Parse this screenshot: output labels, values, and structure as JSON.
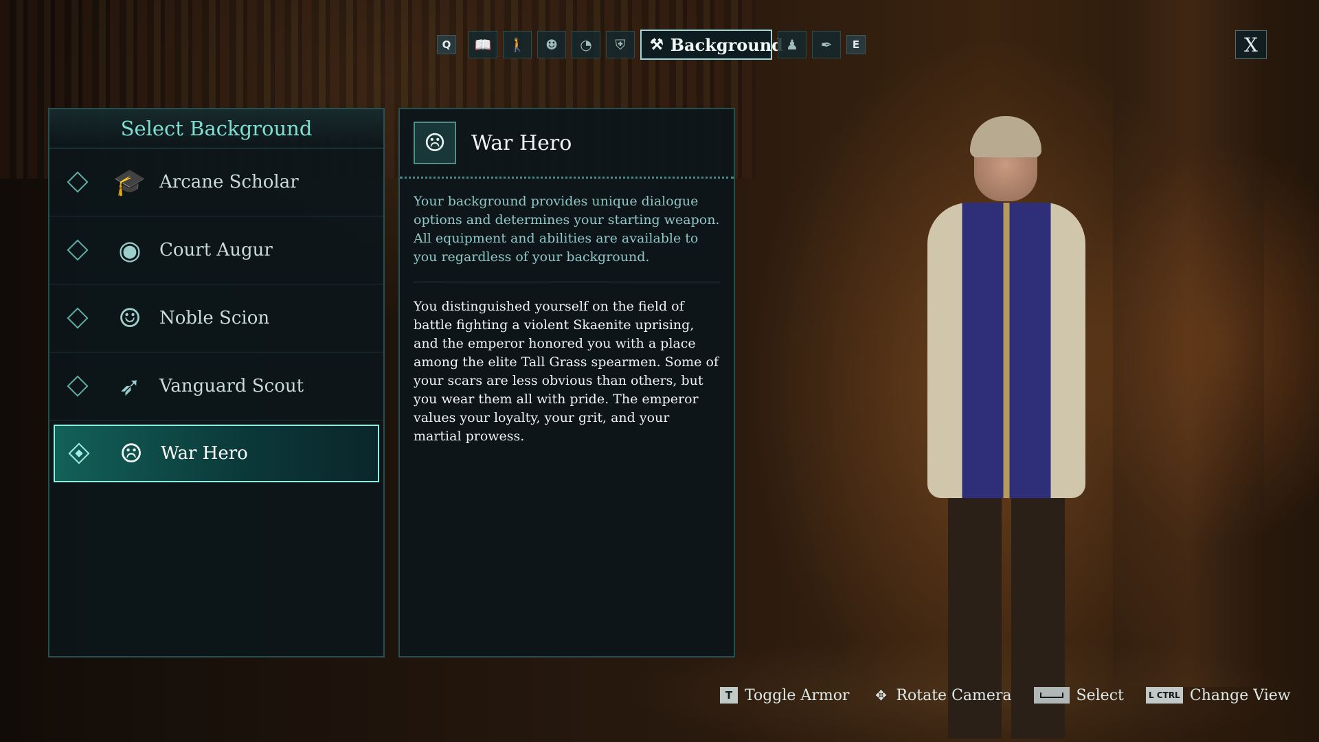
{
  "tabs": {
    "prev_key": "Q",
    "next_key": "E",
    "items": [
      {
        "icon": "book-icon",
        "glyph": "📖"
      },
      {
        "icon": "body-icon",
        "glyph": "🚶"
      },
      {
        "icon": "face-icon",
        "glyph": "☻"
      },
      {
        "icon": "head-icon",
        "glyph": "◔"
      },
      {
        "icon": "shield-icon",
        "glyph": "⛨"
      },
      {
        "icon": "background-icon",
        "glyph": "⚒",
        "label": "Background",
        "active": true
      },
      {
        "icon": "bust-icon",
        "glyph": "♟"
      },
      {
        "icon": "quill-icon",
        "glyph": "✒"
      }
    ],
    "close_label": "X"
  },
  "select_panel": {
    "title": "Select Background",
    "items": [
      {
        "label": "Arcane Scholar",
        "icon": "mortarboard-icon",
        "glyph": "🎓",
        "selected": false
      },
      {
        "label": "Court Augur",
        "icon": "eye-orb-icon",
        "glyph": "◉",
        "selected": false
      },
      {
        "label": "Noble Scion",
        "icon": "noble-face-icon",
        "glyph": "☺",
        "selected": false
      },
      {
        "label": "Vanguard Scout",
        "icon": "spear-icon",
        "glyph": "➶",
        "selected": false
      },
      {
        "label": "War Hero",
        "icon": "eyepatch-face-icon",
        "glyph": "☹",
        "selected": true
      }
    ]
  },
  "detail": {
    "name": "War Hero",
    "icon": "eyepatch-face-icon",
    "glyph": "☹",
    "intro": "Your background provides unique dialogue options and determines your starting weapon. All equipment and abilities are available to you regardless of your background.",
    "body": "You distinguished yourself on the field of battle fighting a violent Skaenite uprising, and the emperor honored you with a place among the elite Tall Grass spearmen. Some of your scars are less obvious than others, but you wear them all with pride. The emperor values your loyalty, your grit, and your martial prowess."
  },
  "hints": {
    "toggle_armor_key": "T",
    "toggle_armor": "Toggle Armor",
    "rotate_camera": "Rotate Camera",
    "select": "Select",
    "change_view_key": "L CTRL",
    "change_view": "Change View"
  },
  "colors": {
    "accent": "#7fe0d2",
    "selected_border": "#8ff0e0",
    "panel_bg": "#0c161a"
  }
}
